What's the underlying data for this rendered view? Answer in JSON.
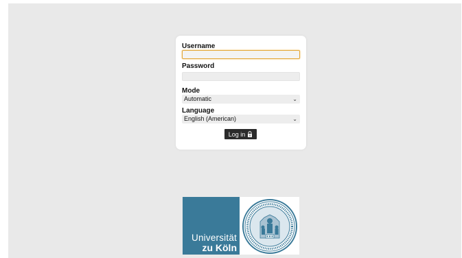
{
  "login": {
    "username_label": "Username",
    "username_value": "",
    "password_label": "Password",
    "password_value": "",
    "mode_label": "Mode",
    "mode_selected": "Automatic",
    "language_label": "Language",
    "language_selected": "English (American)",
    "login_button_label": "Log in",
    "login_button_icon": "lock-icon"
  },
  "logo": {
    "line1": "Universität",
    "line2": "zu Köln",
    "panel_color": "#3a7a99",
    "seal_icon": "university-seal-icon"
  },
  "colors": {
    "background": "#e9e9e9",
    "focus_border": "#e3a636",
    "button": "#2b2b2b"
  }
}
